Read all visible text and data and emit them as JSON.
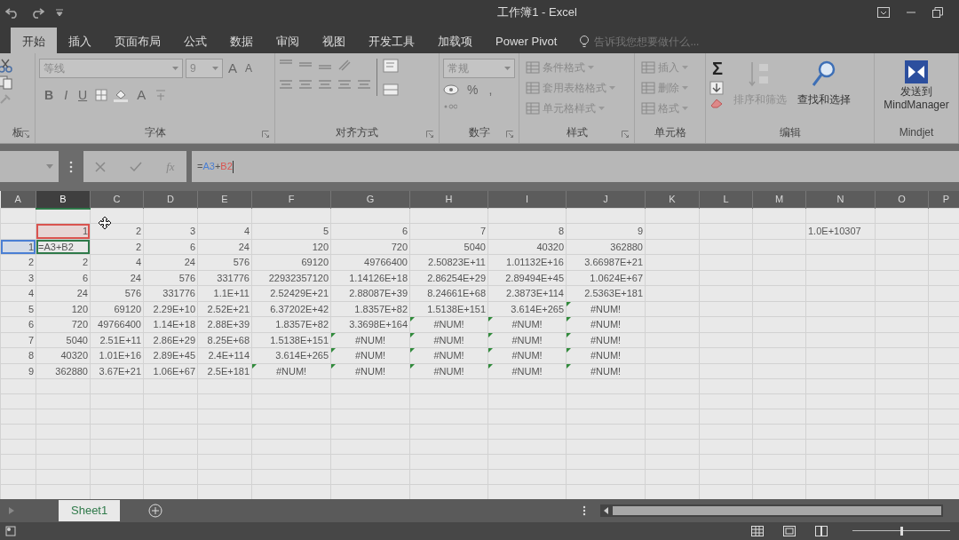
{
  "window": {
    "title": "工作簿1 - Excel"
  },
  "ribbon_tabs": [
    {
      "label": "开始",
      "selected": true
    },
    {
      "label": "插入",
      "selected": false
    },
    {
      "label": "页面布局",
      "selected": false
    },
    {
      "label": "公式",
      "selected": false
    },
    {
      "label": "数据",
      "selected": false
    },
    {
      "label": "审阅",
      "selected": false
    },
    {
      "label": "视图",
      "selected": false
    },
    {
      "label": "开发工具",
      "selected": false
    },
    {
      "label": "加载项",
      "selected": false
    },
    {
      "label": "Power Pivot",
      "selected": false
    }
  ],
  "search": {
    "placeholder": "告诉我您想要做什么..."
  },
  "ribbon_groups": [
    {
      "kind": "clipboard",
      "label": "板"
    },
    {
      "kind": "font",
      "label": "字体",
      "font_name": "等线",
      "font_size": "9",
      "size_buttons": [
        "A",
        "A"
      ],
      "style_buttons": [
        "B",
        "I",
        "U"
      ],
      "color_button": "A"
    },
    {
      "kind": "alignment",
      "label": "对齐方式"
    },
    {
      "kind": "number",
      "label": "数字",
      "format": "常规",
      "symbols": [
        "%",
        ","
      ]
    },
    {
      "kind": "styles",
      "label": "样式",
      "items": [
        "条件格式",
        "套用表格格式",
        "单元格样式"
      ]
    },
    {
      "kind": "cells",
      "label": "单元格",
      "items": [
        "插入",
        "删除",
        "格式"
      ]
    },
    {
      "kind": "editing",
      "label": "编辑",
      "sum_symbol": "Σ",
      "items": [
        {
          "label": "排序和筛选",
          "disabled": true
        },
        {
          "label": "查找和选择",
          "disabled": false
        }
      ]
    },
    {
      "kind": "mindjet",
      "label": "Mindjet",
      "button": [
        "发送到",
        "MindManager"
      ]
    }
  ],
  "formula_bar": {
    "function_label": "fx",
    "formula": [
      {
        "text": "=",
        "color": "#555555"
      },
      {
        "text": "A3",
        "color": "#4a7fd4"
      },
      {
        "text": "+",
        "color": "#555555"
      },
      {
        "text": "B2",
        "color": "#d9534f"
      }
    ]
  },
  "columns": [
    {
      "label": "A",
      "selected": false
    },
    {
      "label": "B",
      "selected": true
    },
    {
      "label": "C",
      "selected": false
    },
    {
      "label": "D",
      "selected": false
    },
    {
      "label": "E",
      "selected": false
    },
    {
      "label": "F",
      "selected": false
    },
    {
      "label": "G",
      "selected": false
    },
    {
      "label": "H",
      "selected": false
    },
    {
      "label": "I",
      "selected": false
    },
    {
      "label": "J",
      "selected": false
    },
    {
      "label": "K",
      "selected": false
    },
    {
      "label": "L",
      "selected": false
    },
    {
      "label": "M",
      "selected": false
    },
    {
      "label": "N",
      "selected": false
    },
    {
      "label": "O",
      "selected": false
    },
    {
      "label": "P",
      "selected": false
    }
  ],
  "rows": [
    {
      "cells": []
    },
    {
      "cells": [
        null,
        {
          "text": "1",
          "color": "#d9534f"
        },
        "2",
        "3",
        "4",
        "5",
        "6",
        "7",
        "8",
        "9",
        null,
        null,
        null,
        {
          "text": "1.0E+10307",
          "kind": "text"
        }
      ]
    },
    {
      "cells": [
        {
          "text": "1",
          "color": "#4a7fd4"
        },
        {
          "text": "=A3+B2",
          "kind": "text",
          "editing": true
        },
        "2",
        "6",
        "24",
        "120",
        "720",
        "5040",
        "40320",
        "362880"
      ]
    },
    {
      "cells": [
        "2",
        "2",
        "4",
        "24",
        "576",
        "69120",
        "49766400",
        "2.50823E+11",
        "1.01132E+16",
        "3.66987E+21"
      ]
    },
    {
      "cells": [
        "3",
        "6",
        "24",
        "576",
        "331776",
        "22932357120",
        "1.14126E+18",
        "2.86254E+29",
        "2.89494E+45",
        "1.0624E+67"
      ]
    },
    {
      "cells": [
        "4",
        "24",
        "576",
        "331776",
        "1.1E+11",
        "2.52429E+21",
        "2.88087E+39",
        "8.24661E+68",
        "2.3873E+114",
        "2.5363E+181"
      ]
    },
    {
      "cells": [
        "5",
        "120",
        "69120",
        "2.29E+10",
        "2.52E+21",
        "6.37202E+42",
        "1.8357E+82",
        "1.5138E+151",
        "3.614E+265",
        {
          "text": "#NUM!",
          "kind": "error"
        }
      ]
    },
    {
      "cells": [
        "6",
        "720",
        "49766400",
        "1.14E+18",
        "2.88E+39",
        "1.8357E+82",
        "3.3698E+164",
        {
          "text": "#NUM!",
          "kind": "error"
        },
        {
          "text": "#NUM!",
          "kind": "error"
        },
        {
          "text": "#NUM!",
          "kind": "error"
        }
      ]
    },
    {
      "cells": [
        "7",
        "5040",
        "2.51E+11",
        "2.86E+29",
        "8.25E+68",
        "1.5138E+151",
        {
          "text": "#NUM!",
          "kind": "error"
        },
        {
          "text": "#NUM!",
          "kind": "error"
        },
        {
          "text": "#NUM!",
          "kind": "error"
        },
        {
          "text": "#NUM!",
          "kind": "error"
        }
      ]
    },
    {
      "cells": [
        "8",
        "40320",
        "1.01E+16",
        "2.89E+45",
        "2.4E+114",
        "3.614E+265",
        {
          "text": "#NUM!",
          "kind": "error"
        },
        {
          "text": "#NUM!",
          "kind": "error"
        },
        {
          "text": "#NUM!",
          "kind": "error"
        },
        {
          "text": "#NUM!",
          "kind": "error"
        }
      ]
    },
    {
      "cells": [
        "9",
        "362880",
        "3.67E+21",
        "1.06E+67",
        "2.5E+181",
        {
          "text": "#NUM!",
          "kind": "error"
        },
        {
          "text": "#NUM!",
          "kind": "error"
        },
        {
          "text": "#NUM!",
          "kind": "error"
        },
        {
          "text": "#NUM!",
          "kind": "error"
        },
        {
          "text": "#NUM!",
          "kind": "error"
        }
      ]
    }
  ],
  "sheet_tabs": [
    {
      "label": "Sheet1",
      "selected": true
    }
  ],
  "status_bar": {
    "zoom_slider": {
      "level": 0.5
    }
  }
}
